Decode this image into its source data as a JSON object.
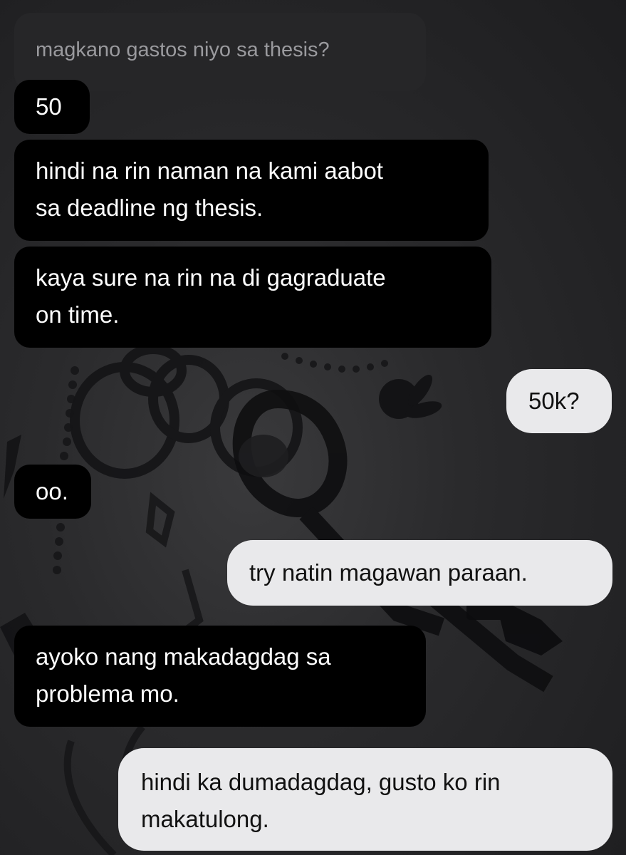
{
  "messages": [
    {
      "id": "m0",
      "sender": "other",
      "type": "reply-preview",
      "lines": [
        "magkano gastos niyo sa thesis?"
      ]
    },
    {
      "id": "m1",
      "sender": "other",
      "lines": [
        "50"
      ]
    },
    {
      "id": "m2",
      "sender": "other",
      "lines": [
        "hindi na rin naman na kami aabot",
        "sa deadline ng thesis."
      ]
    },
    {
      "id": "m3",
      "sender": "other",
      "lines": [
        "kaya sure na rin na di gagraduate",
        "on time."
      ]
    },
    {
      "id": "m4",
      "sender": "me",
      "lines": [
        "50k?"
      ]
    },
    {
      "id": "m5",
      "sender": "other",
      "lines": [
        "oo."
      ]
    },
    {
      "id": "m6",
      "sender": "me",
      "lines": [
        "try natin magawan paraan."
      ]
    },
    {
      "id": "m7",
      "sender": "other",
      "lines": [
        "ayoko nang makadagdag sa",
        "problema mo."
      ]
    },
    {
      "id": "m8",
      "sender": "me",
      "lines": [
        "hindi ka dumadagdag, gusto ko rin",
        "makatulong."
      ]
    }
  ],
  "colors": {
    "incoming_bg": "#000000",
    "incoming_text": "#ffffff",
    "outgoing_bg": "#e9e9eb",
    "outgoing_text": "#111111",
    "reply_preview_bg": "#262628",
    "reply_preview_text": "#9a9a9e",
    "chat_background": "#2a2a2c"
  },
  "background_art": "dark-keychain-wallpaper"
}
